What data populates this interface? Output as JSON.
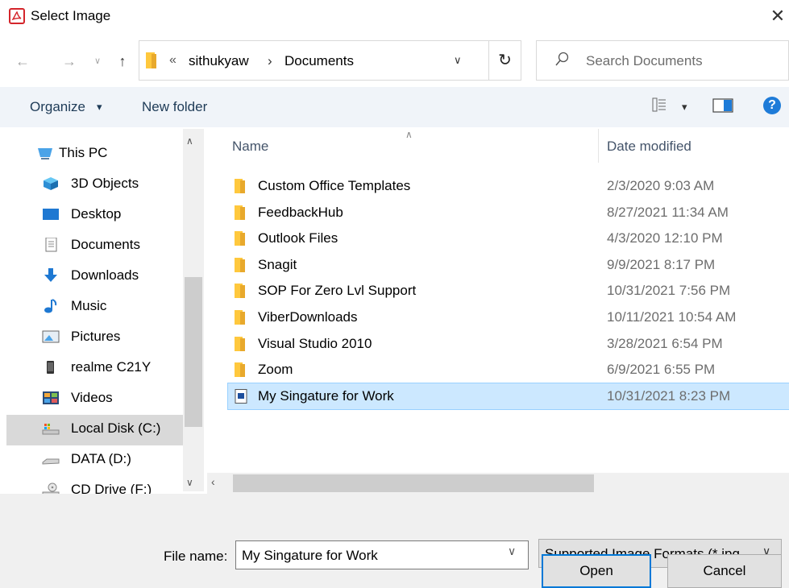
{
  "window": {
    "title": "Select Image",
    "app_icon": "pdf-app-icon",
    "close_glyph": "✕"
  },
  "nav": {
    "back_glyph": "←",
    "forward_glyph": "→",
    "recent_glyph": "∨",
    "up_glyph": "↑",
    "breadcrumb_overflow": "«",
    "path": [
      "sithukyaw",
      "Documents"
    ],
    "path_sep": "›",
    "path_dropdown_glyph": "∨",
    "refresh_glyph": "↻",
    "search_placeholder": "Search Documents"
  },
  "toolbar": {
    "organize_label": "Organize",
    "organize_caret": "▾",
    "new_folder_label": "New folder",
    "view_caret": "▾",
    "help_glyph": "?"
  },
  "sidebar": {
    "items": [
      {
        "label": "This PC",
        "icon": "pc-icon"
      },
      {
        "label": "3D Objects",
        "icon": "3d-objects-icon"
      },
      {
        "label": "Desktop",
        "icon": "desktop-icon"
      },
      {
        "label": "Documents",
        "icon": "documents-icon"
      },
      {
        "label": "Downloads",
        "icon": "downloads-icon"
      },
      {
        "label": "Music",
        "icon": "music-icon"
      },
      {
        "label": "Pictures",
        "icon": "pictures-icon"
      },
      {
        "label": "realme C21Y",
        "icon": "phone-icon"
      },
      {
        "label": "Videos",
        "icon": "videos-icon"
      },
      {
        "label": "Local Disk (C:)",
        "icon": "local-disk-icon",
        "selected": true
      },
      {
        "label": "DATA (D:)",
        "icon": "drive-icon"
      },
      {
        "label": "CD Drive (F:)",
        "icon": "cd-drive-icon"
      }
    ]
  },
  "filelist": {
    "columns": [
      "Name",
      "Date modified"
    ],
    "rows": [
      {
        "name": "Custom Office Templates",
        "date": "2/3/2020 9:03 AM",
        "type": "folder"
      },
      {
        "name": "FeedbackHub",
        "date": "8/27/2021 11:34 AM",
        "type": "folder"
      },
      {
        "name": "Outlook Files",
        "date": "4/3/2020 12:10 PM",
        "type": "folder"
      },
      {
        "name": "Snagit",
        "date": "9/9/2021 8:17 PM",
        "type": "folder"
      },
      {
        "name": "SOP For Zero Lvl Support",
        "date": "10/31/2021 7:56 PM",
        "type": "folder"
      },
      {
        "name": "ViberDownloads",
        "date": "10/11/2021 10:54 AM",
        "type": "folder"
      },
      {
        "name": "Visual Studio 2010",
        "date": "3/28/2021 6:54 PM",
        "type": "folder"
      },
      {
        "name": "Zoom",
        "date": "6/9/2021 6:55 PM",
        "type": "folder"
      },
      {
        "name": "My Singature for Work",
        "date": "10/31/2021 8:23 PM",
        "type": "image",
        "selected": true
      }
    ]
  },
  "footer": {
    "file_name_label": "File name:",
    "file_name_value": "My Singature for Work",
    "file_type_value": "Supported Image Formats (*.jpg",
    "dropdown_glyph": "∨",
    "open_label": "Open",
    "cancel_label": "Cancel"
  },
  "colors": {
    "folder": "#ffc83d",
    "selection": "#cce8ff",
    "accent": "#0078d7",
    "help": "#1e7bd8"
  }
}
